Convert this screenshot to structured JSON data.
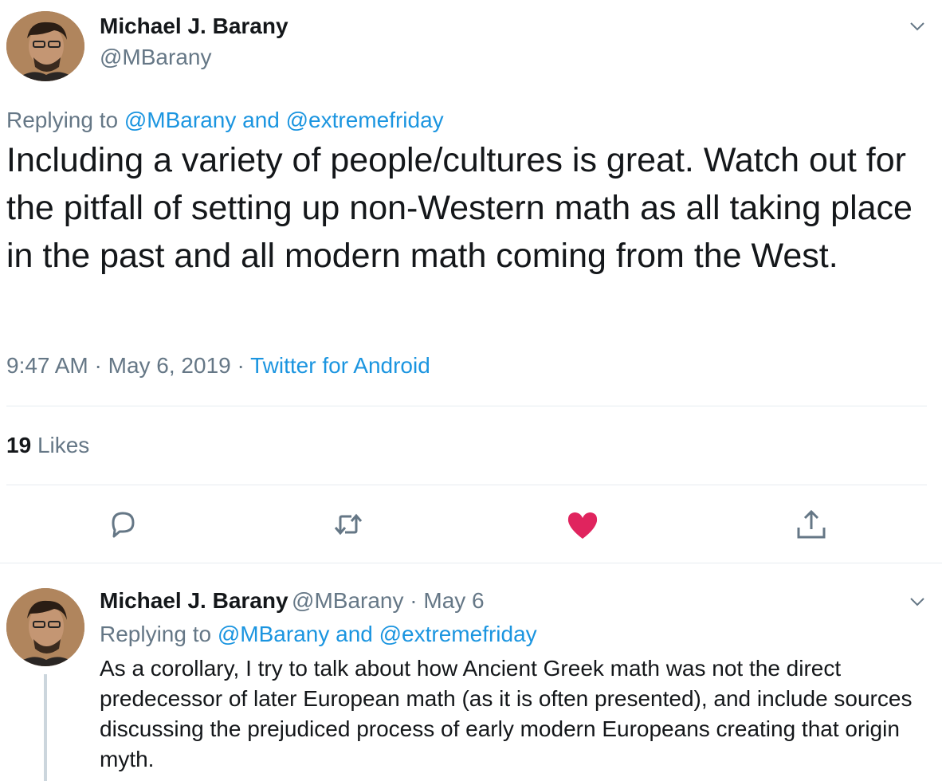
{
  "main_tweet": {
    "author_name": "Michael J. Barany",
    "author_handle": "@MBarany",
    "replying_prefix": "Replying to ",
    "replying_handle_1": "@MBarany",
    "replying_and": " and ",
    "replying_handle_2": "@extremefriday",
    "text": "Including a variety of people/cultures is great. Watch out for the pitfall of setting up non-Western math as all taking place in the past and all modern math coming from the West.",
    "time": "9:47 AM",
    "separator": " · ",
    "date": "May 6, 2019",
    "source": "Twitter for Android",
    "likes_count": "19",
    "likes_label": "Likes",
    "icons": {
      "menu": "chevron-down-icon",
      "reply": "reply-icon",
      "retweet": "retweet-icon",
      "like": "heart-icon",
      "share": "share-icon"
    },
    "like_color": "#e0245e"
  },
  "reply_tweet": {
    "author_name": "Michael J. Barany",
    "author_handle": "@MBarany",
    "separator": " · ",
    "date": "May 6",
    "replying_prefix": "Replying to ",
    "replying_handle_1": "@MBarany",
    "replying_and": " and ",
    "replying_handle_2": "@extremefriday",
    "text": "As a corollary, I try to talk about how Ancient Greek math was not the direct predecessor of later European math (as it is often presented), and include sources discussing the prejudiced process of early modern Europeans creating that origin myth."
  },
  "colors": {
    "link": "#1b95e0",
    "muted": "#657786",
    "text": "#14171a",
    "divider": "#e6ecf0"
  }
}
